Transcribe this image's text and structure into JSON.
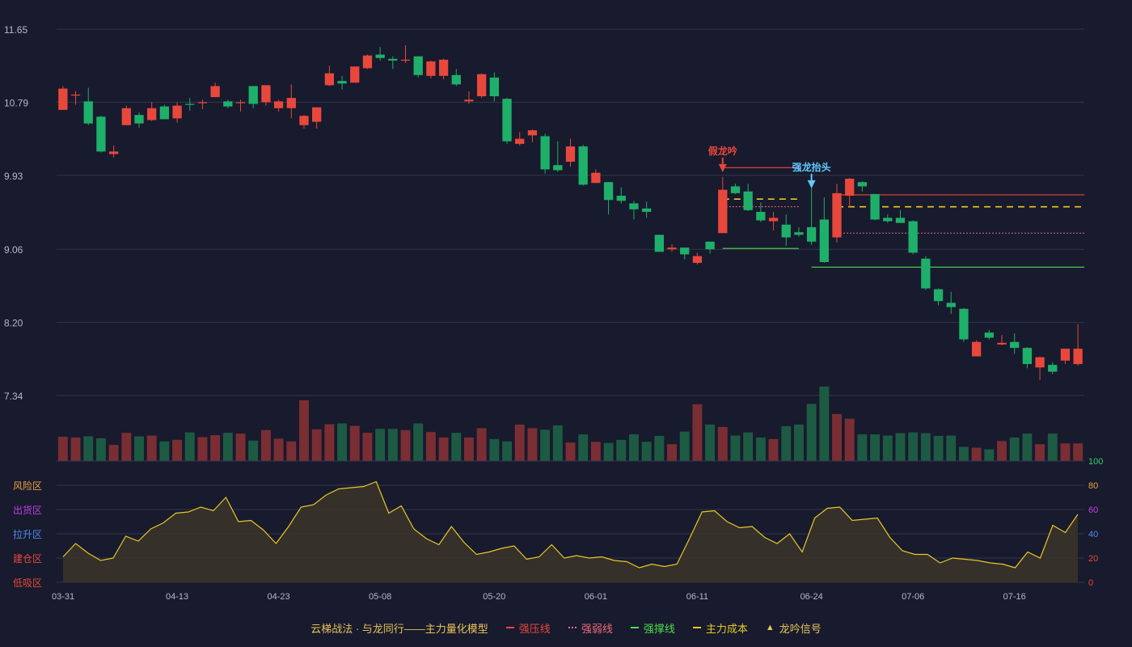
{
  "chart_data": {
    "type": "candlestick",
    "dates": [
      "03-31",
      "04-01",
      "04-02",
      "04-03",
      "04-06",
      "04-07",
      "04-08",
      "04-09",
      "04-10",
      "04-13",
      "04-14",
      "04-15",
      "04-16",
      "04-17",
      "04-20",
      "04-21",
      "04-22",
      "04-23",
      "04-24",
      "04-27",
      "04-28",
      "04-29",
      "04-30",
      "05-06",
      "05-07",
      "05-08",
      "05-09",
      "05-11",
      "05-12",
      "05-13",
      "05-14",
      "05-15",
      "05-18",
      "05-19",
      "05-20",
      "05-21",
      "05-22",
      "05-25",
      "05-26",
      "05-27",
      "05-28",
      "05-29",
      "06-01",
      "06-02",
      "06-03",
      "06-04",
      "06-05",
      "06-08",
      "06-09",
      "06-10",
      "06-11",
      "06-12",
      "06-15",
      "06-16",
      "06-17",
      "06-18",
      "06-19",
      "06-22",
      "06-23",
      "06-24",
      "06-25",
      "06-26",
      "06-29",
      "06-30",
      "07-01",
      "07-02",
      "07-03",
      "07-06",
      "07-07",
      "07-08",
      "07-09",
      "07-10",
      "07-13",
      "07-14",
      "07-15",
      "07-16",
      "07-17",
      "07-20",
      "07-21",
      "07-22",
      "07-23"
    ],
    "x_tick_labels": [
      "03-31",
      "04-13",
      "04-23",
      "05-08",
      "05-20",
      "06-01",
      "06-11",
      "06-24",
      "07-06",
      "07-16"
    ],
    "price_axis": {
      "ticks": [
        "11.65",
        "10.79",
        "9.93",
        "9.06",
        "8.20",
        "7.34"
      ],
      "min": 7.34,
      "max": 11.65
    },
    "ohlc": [
      [
        10.7,
        10.95,
        10.7,
        10.98
      ],
      [
        10.88,
        10.88,
        10.76,
        10.92
      ],
      [
        10.8,
        10.54,
        10.52,
        10.96
      ],
      [
        10.62,
        10.21,
        10.2,
        10.63
      ],
      [
        10.18,
        10.21,
        10.14,
        10.28
      ],
      [
        10.52,
        10.72,
        10.52,
        10.75
      ],
      [
        10.64,
        10.54,
        10.49,
        10.67
      ],
      [
        10.58,
        10.72,
        10.57,
        10.79
      ],
      [
        10.74,
        10.59,
        10.59,
        10.76
      ],
      [
        10.6,
        10.75,
        10.55,
        10.79
      ],
      [
        10.77,
        10.76,
        10.69,
        10.84
      ],
      [
        10.78,
        10.79,
        10.71,
        10.82
      ],
      [
        10.85,
        10.98,
        10.85,
        11.02
      ],
      [
        10.8,
        10.74,
        10.72,
        10.82
      ],
      [
        10.78,
        10.79,
        10.68,
        10.82
      ],
      [
        10.98,
        10.77,
        10.72,
        10.98
      ],
      [
        10.79,
        10.99,
        10.75,
        10.99
      ],
      [
        10.72,
        10.8,
        10.68,
        10.82
      ],
      [
        10.72,
        10.84,
        10.6,
        11.0
      ],
      [
        10.52,
        10.63,
        10.48,
        10.64
      ],
      [
        10.56,
        10.73,
        10.48,
        10.73
      ],
      [
        10.99,
        11.13,
        10.98,
        11.22
      ],
      [
        11.04,
        11.01,
        10.94,
        11.1
      ],
      [
        11.02,
        11.21,
        11.02,
        11.21
      ],
      [
        11.19,
        11.34,
        11.18,
        11.35
      ],
      [
        11.35,
        11.31,
        11.28,
        11.44
      ],
      [
        11.3,
        11.28,
        11.18,
        11.33
      ],
      [
        11.29,
        11.29,
        11.25,
        11.46
      ],
      [
        11.33,
        11.11,
        11.08,
        11.33
      ],
      [
        11.1,
        11.27,
        11.07,
        11.28
      ],
      [
        11.1,
        11.29,
        11.06,
        11.3
      ],
      [
        11.11,
        11.0,
        10.98,
        11.18
      ],
      [
        10.8,
        10.82,
        10.77,
        10.92
      ],
      [
        10.86,
        11.12,
        10.84,
        11.13
      ],
      [
        11.08,
        10.86,
        10.8,
        11.14
      ],
      [
        10.83,
        10.33,
        10.3,
        10.84
      ],
      [
        10.3,
        10.36,
        10.28,
        10.44
      ],
      [
        10.4,
        10.46,
        10.32,
        10.47
      ],
      [
        10.39,
        10.0,
        9.95,
        10.42
      ],
      [
        10.05,
        9.99,
        9.97,
        10.33
      ],
      [
        10.09,
        10.27,
        10.03,
        10.36
      ],
      [
        10.27,
        9.82,
        9.81,
        10.29
      ],
      [
        9.84,
        9.96,
        9.84,
        10.0
      ],
      [
        9.85,
        9.64,
        9.47,
        9.85
      ],
      [
        9.69,
        9.63,
        9.6,
        9.79
      ],
      [
        9.6,
        9.53,
        9.41,
        9.63
      ],
      [
        9.54,
        9.5,
        9.43,
        9.62
      ],
      [
        9.23,
        9.03,
        9.26,
        9.07
      ],
      [
        9.06,
        9.08,
        9.03,
        9.12
      ],
      [
        9.08,
        9.0,
        8.94,
        9.08
      ],
      [
        8.9,
        8.98,
        8.88,
        9.02
      ],
      [
        9.15,
        9.06,
        9.01,
        9.12
      ],
      [
        9.25,
        9.76,
        9.25,
        9.91
      ],
      [
        9.8,
        9.72,
        9.71,
        9.83
      ],
      [
        9.74,
        9.52,
        9.51,
        9.83
      ],
      [
        9.5,
        9.4,
        9.38,
        9.61
      ],
      [
        9.39,
        9.43,
        9.28,
        9.5
      ],
      [
        9.35,
        9.2,
        9.1,
        9.47
      ],
      [
        9.26,
        9.23,
        9.21,
        9.32
      ],
      [
        9.32,
        9.15,
        9.11,
        9.82
      ],
      [
        9.41,
        8.91,
        8.9,
        9.67
      ],
      [
        9.2,
        9.72,
        9.14,
        9.83
      ],
      [
        9.69,
        9.89,
        9.55,
        9.9
      ],
      [
        9.85,
        9.8,
        9.74,
        9.86
      ],
      [
        9.71,
        9.41,
        9.4,
        9.71
      ],
      [
        9.43,
        9.39,
        9.37,
        9.47
      ],
      [
        9.43,
        9.37,
        9.37,
        9.52
      ],
      [
        9.39,
        9.02,
        9.0,
        9.4
      ],
      [
        8.95,
        8.6,
        8.58,
        8.98
      ],
      [
        8.59,
        8.45,
        8.4,
        8.6
      ],
      [
        8.43,
        8.38,
        8.3,
        8.56
      ],
      [
        8.36,
        8.0,
        7.97,
        8.37
      ],
      [
        7.8,
        7.97,
        7.91,
        7.99
      ],
      [
        8.08,
        8.02,
        8.0,
        8.11
      ],
      [
        7.94,
        7.96,
        7.93,
        8.05
      ],
      [
        7.97,
        7.9,
        7.83,
        8.07
      ],
      [
        7.9,
        7.71,
        7.66,
        7.91
      ],
      [
        7.67,
        7.79,
        7.52,
        7.8
      ],
      [
        7.7,
        7.62,
        7.59,
        7.73
      ],
      [
        7.75,
        7.89,
        7.71,
        7.89
      ],
      [
        7.71,
        7.89,
        7.69,
        8.18
      ]
    ],
    "volume": [
      6.2,
      6.0,
      6.3,
      5.8,
      4.1,
      7.2,
      6.3,
      6.5,
      5.0,
      5.4,
      7.3,
      6.1,
      6.6,
      7.2,
      7.0,
      5.2,
      7.9,
      5.7,
      5.0,
      15.5,
      8.1,
      9.4,
      9.6,
      9.0,
      7.2,
      8.2,
      8.2,
      7.9,
      9.6,
      7.4,
      6.0,
      7.2,
      6.0,
      8.4,
      5.6,
      5.0,
      9.3,
      8.4,
      8.0,
      9.1,
      4.7,
      6.8,
      4.9,
      4.6,
      5.4,
      6.8,
      4.9,
      6.4,
      4.3,
      7.5,
      14.5,
      9.3,
      8.7,
      6.5,
      7.3,
      6.0,
      5.6,
      8.9,
      9.3,
      14.6,
      19.0,
      12.0,
      10.8,
      6.8,
      6.8,
      6.5,
      7.1,
      7.3,
      7.1,
      6.4,
      6.5,
      3.6,
      3.4,
      3.0,
      5.1,
      6.0,
      7.0,
      4.3,
      7.0,
      4.5,
      4.5
    ],
    "up_color": "#e8483c",
    "down_color": "#1eb06a",
    "markers": [
      {
        "label": "假龙吟",
        "index": 52,
        "price": 9.91,
        "color": "#e8483c"
      },
      {
        "label": "强龙抬头",
        "index": 59,
        "price": 9.72,
        "color": "#60c8ff"
      }
    ],
    "lines": {
      "strong_pressure": [
        {
          "from": 52,
          "to": 58,
          "price": 10.02
        },
        {
          "from": 61,
          "to": 80,
          "price": 9.7
        }
      ],
      "weak_pressure": [
        {
          "from": 52,
          "to": 58,
          "price": 9.56
        },
        {
          "from": 61,
          "to": 80,
          "price": 9.25
        }
      ],
      "support": [
        {
          "from": 52,
          "to": 58,
          "price": 9.07
        },
        {
          "from": 59,
          "to": 80,
          "price": 8.85
        }
      ],
      "main_cost": [
        {
          "from": 52,
          "to": 58,
          "price": 9.65
        },
        {
          "from": 61,
          "to": 80,
          "price": 9.56
        }
      ]
    },
    "indicator": {
      "values": [
        21,
        32,
        24,
        18,
        20,
        38,
        34,
        44,
        49,
        57,
        58,
        62,
        59,
        70,
        50,
        51,
        43,
        32,
        46,
        62,
        64,
        72,
        77,
        78,
        79,
        83,
        57,
        63,
        44,
        36,
        31,
        46,
        33,
        23,
        25,
        28,
        30,
        19,
        21,
        31,
        20,
        22,
        20,
        21,
        18,
        17,
        12,
        15,
        13,
        15,
        36,
        58,
        59,
        50,
        45,
        46,
        37,
        32,
        40,
        25,
        53,
        61,
        62,
        51,
        52,
        53,
        37,
        26,
        23,
        23,
        16,
        20,
        19,
        18,
        16,
        15,
        12,
        25,
        20,
        47,
        41,
        56
      ],
      "right_ticks": [
        "0",
        "20",
        "40",
        "60",
        "80",
        "100"
      ],
      "zone_labels": [
        "风险区",
        "出货区",
        "拉升区",
        "建仓区",
        "低吸区"
      ],
      "zone_colors": [
        "#e8a444",
        "#c040e8",
        "#4d8ef0",
        "#e8483c",
        "#e8483c"
      ],
      "right_tick_colors": [
        "#e8483c",
        "#e8483c",
        "#4d8ef0",
        "#c040e8",
        "#e8a444",
        "#38d06a"
      ],
      "line_color": "#e8c826"
    }
  },
  "legend": {
    "title": "云梯战法 · 与龙同行——主力量化模型",
    "items": [
      {
        "label": "强压线",
        "color": "#e8483c",
        "style": "solid"
      },
      {
        "label": "强弱线",
        "color": "#f06a7a",
        "style": "dotted"
      },
      {
        "label": "强撑线",
        "color": "#4ddc4d",
        "style": "solid"
      },
      {
        "label": "主力成本",
        "color": "#e8c826",
        "style": "dashed"
      },
      {
        "label": "龙吟信号",
        "color": "#e8c35a",
        "style": "triangle",
        "symbol": "▲"
      }
    ]
  }
}
